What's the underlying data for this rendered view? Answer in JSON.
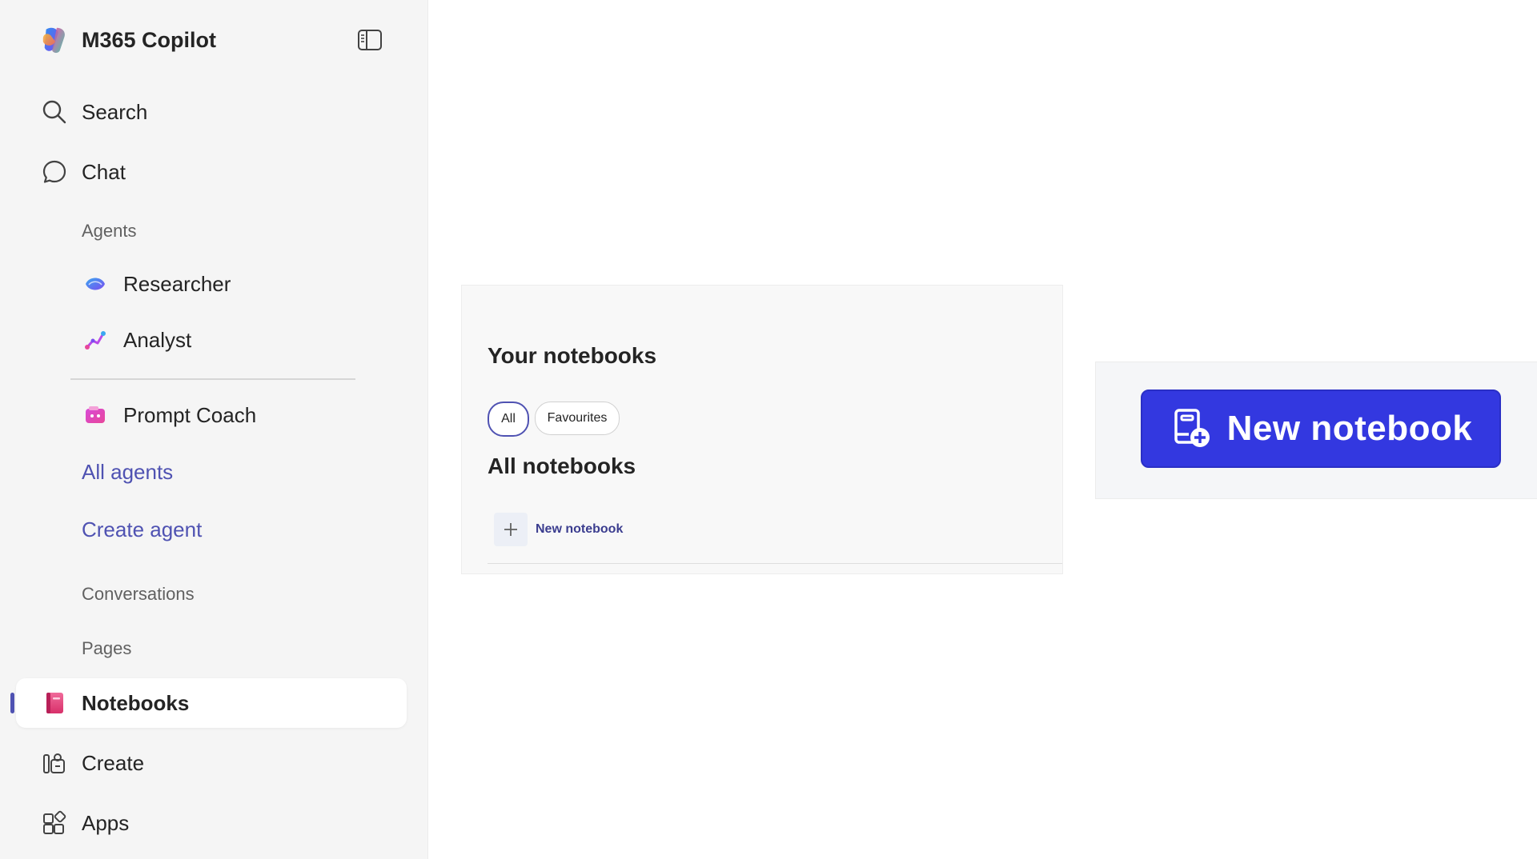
{
  "app": {
    "title": "M365 Copilot"
  },
  "sidebar": {
    "nav": {
      "search": "Search",
      "chat": "Chat"
    },
    "agents_label": "Agents",
    "agents": [
      {
        "label": "Researcher"
      },
      {
        "label": "Analyst"
      },
      {
        "label": "Prompt Coach"
      }
    ],
    "all_agents": "All agents",
    "create_agent": "Create agent",
    "conversations_label": "Conversations",
    "pages_label": "Pages",
    "notebooks": "Notebooks",
    "create": "Create",
    "apps": "Apps"
  },
  "notebooks_panel": {
    "title": "Your notebooks",
    "filters": {
      "all": "All",
      "favourites": "Favourites"
    },
    "section_title": "All notebooks",
    "new_notebook": "New notebook"
  },
  "callout": {
    "button_label": "New notebook"
  },
  "colors": {
    "accent": "#4f52b2",
    "primary_button": "#3338e0",
    "sidebar_bg": "#f5f5f5"
  }
}
